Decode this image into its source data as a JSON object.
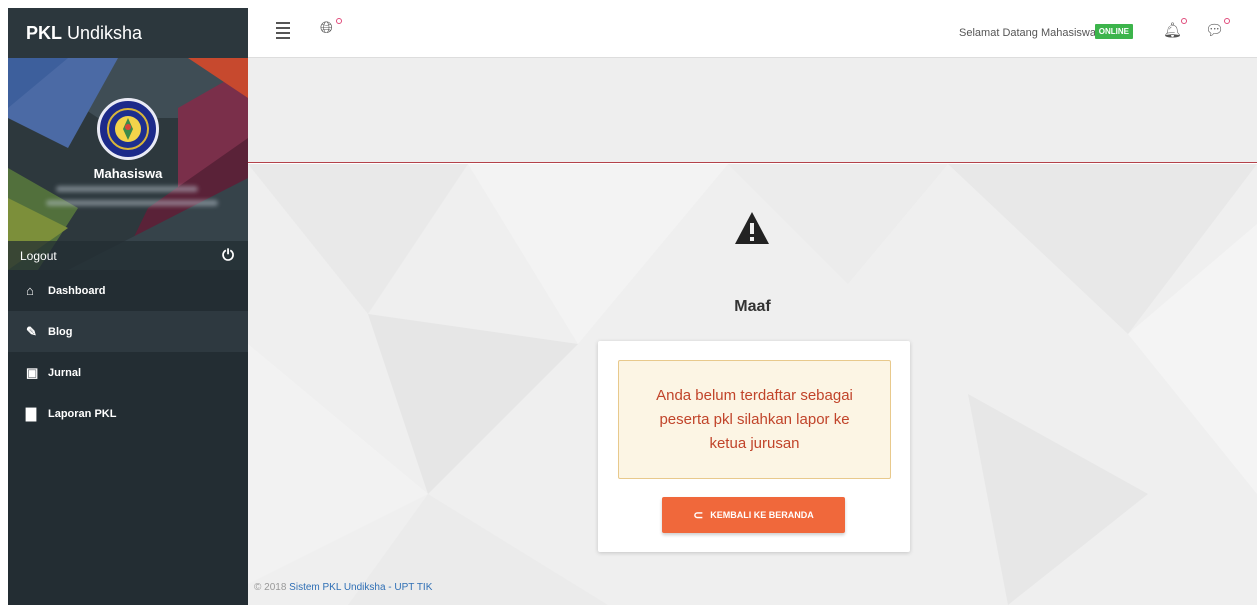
{
  "brand": {
    "bold": "PKL",
    "light": "Undiksha"
  },
  "profile": {
    "name": "Mahasiswa",
    "logout_label": "Logout"
  },
  "menu": [
    {
      "label": "Dashboard",
      "icon": "home-icon",
      "glyph": "⌂"
    },
    {
      "label": "Blog",
      "icon": "pencil-icon",
      "glyph": "✎"
    },
    {
      "label": "Jurnal",
      "icon": "save-icon",
      "glyph": "▣"
    },
    {
      "label": "Laporan PKL",
      "icon": "book-icon",
      "glyph": "▇"
    }
  ],
  "topbar": {
    "welcome": "Selamat Datang Mahasiswa",
    "status": "ONLINE",
    "status_color": "#3cb44b"
  },
  "main": {
    "title": "Maaf",
    "message_lines": [
      "Anda belum terdaftar sebagai",
      "peserta pkl silahkan lapor ke",
      "ketua jurusan"
    ],
    "back_button": "KEMBALI KE BERANDA"
  },
  "footer": {
    "prefix": "© 2018 ",
    "link": "Sistem PKL Undiksha - UPT TIK"
  },
  "colors": {
    "sidebar": "#232d33",
    "accent": "#f0683b",
    "alert_text": "#c1442a"
  }
}
